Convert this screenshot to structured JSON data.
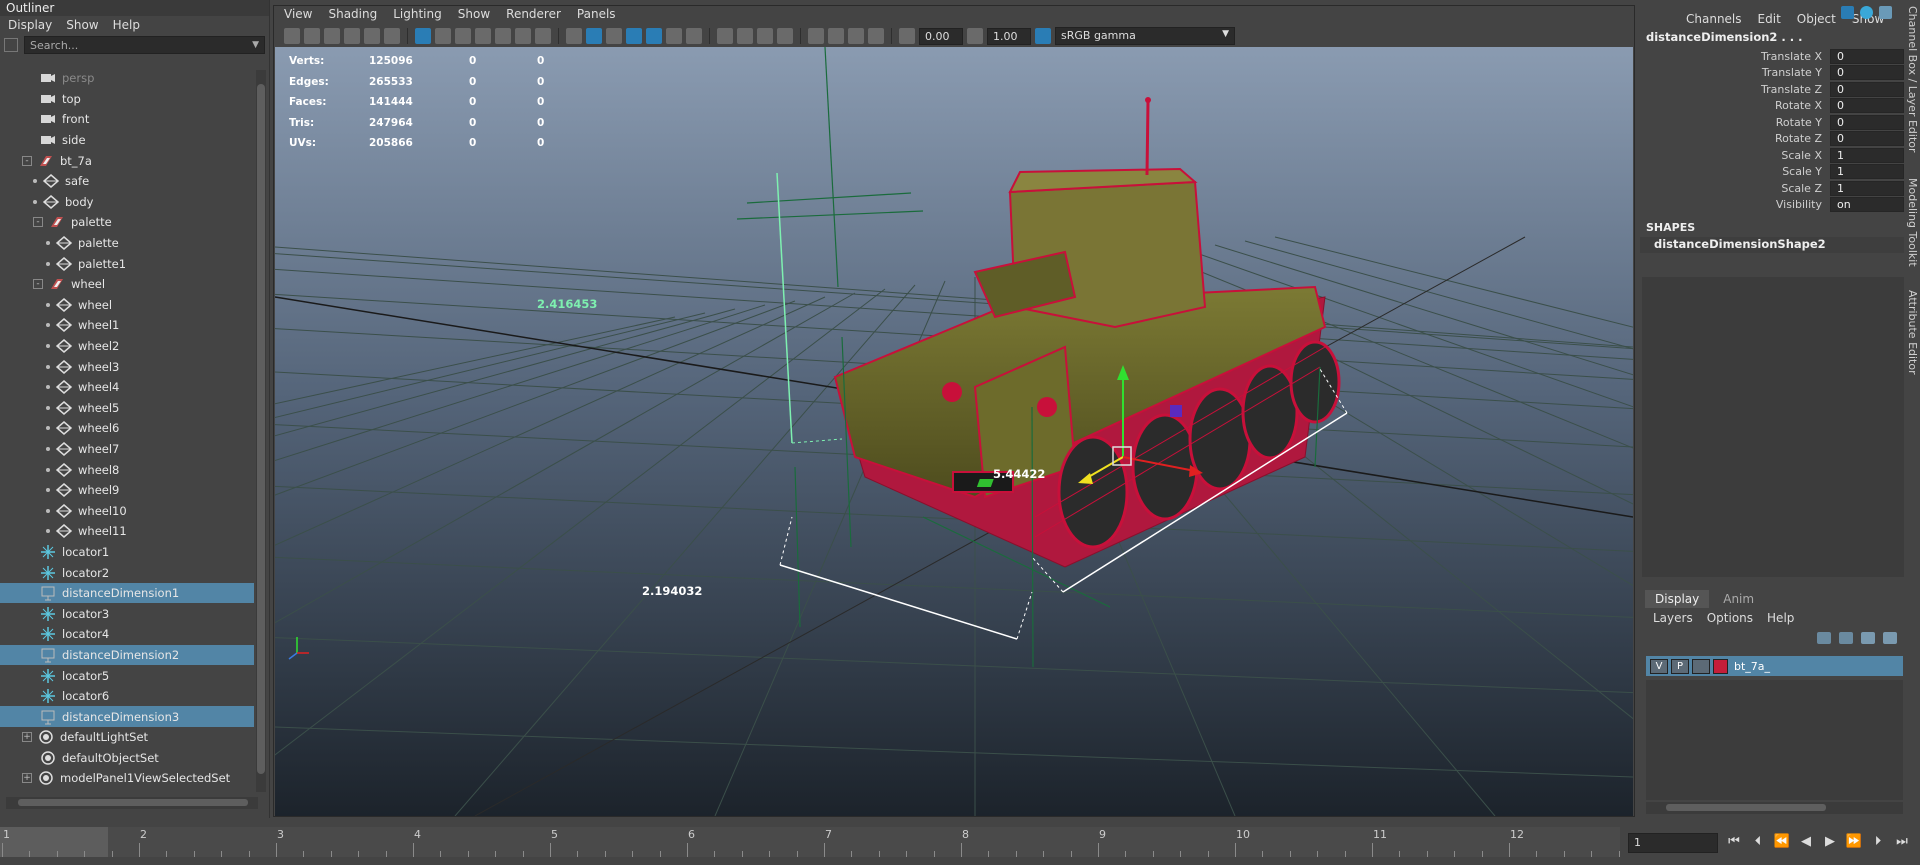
{
  "outliner": {
    "title": "Outliner",
    "menu": [
      "Display",
      "Show",
      "Help"
    ],
    "search_placeholder": "Search...",
    "items": [
      {
        "label": "persp",
        "level": 0,
        "icon": "camera",
        "dim": true
      },
      {
        "label": "top",
        "level": 0,
        "icon": "camera"
      },
      {
        "label": "front",
        "level": 0,
        "icon": "camera"
      },
      {
        "label": "side",
        "level": 0,
        "icon": "camera"
      },
      {
        "label": "bt_7a",
        "level": 0,
        "icon": "group",
        "expander": "-"
      },
      {
        "label": "safe",
        "level": 1,
        "icon": "mesh"
      },
      {
        "label": "body",
        "level": 1,
        "icon": "mesh"
      },
      {
        "label": "palette",
        "level": 1,
        "icon": "group",
        "expander": "-"
      },
      {
        "label": "palette",
        "level": 2,
        "icon": "mesh"
      },
      {
        "label": "palette1",
        "level": 2,
        "icon": "mesh"
      },
      {
        "label": "wheel",
        "level": 1,
        "icon": "group",
        "expander": "-"
      },
      {
        "label": "wheel",
        "level": 2,
        "icon": "mesh"
      },
      {
        "label": "wheel1",
        "level": 2,
        "icon": "mesh"
      },
      {
        "label": "wheel2",
        "level": 2,
        "icon": "mesh"
      },
      {
        "label": "wheel3",
        "level": 2,
        "icon": "mesh"
      },
      {
        "label": "wheel4",
        "level": 2,
        "icon": "mesh"
      },
      {
        "label": "wheel5",
        "level": 2,
        "icon": "mesh"
      },
      {
        "label": "wheel6",
        "level": 2,
        "icon": "mesh"
      },
      {
        "label": "wheel7",
        "level": 2,
        "icon": "mesh"
      },
      {
        "label": "wheel8",
        "level": 2,
        "icon": "mesh"
      },
      {
        "label": "wheel9",
        "level": 2,
        "icon": "mesh"
      },
      {
        "label": "wheel10",
        "level": 2,
        "icon": "mesh"
      },
      {
        "label": "wheel11",
        "level": 2,
        "icon": "mesh"
      },
      {
        "label": "locator1",
        "level": 0,
        "icon": "locator"
      },
      {
        "label": "locator2",
        "level": 0,
        "icon": "locator"
      },
      {
        "label": "distanceDimension1",
        "level": 0,
        "icon": "distance",
        "selected": true
      },
      {
        "label": "locator3",
        "level": 0,
        "icon": "locator"
      },
      {
        "label": "locator4",
        "level": 0,
        "icon": "locator"
      },
      {
        "label": "distanceDimension2",
        "level": 0,
        "icon": "distance",
        "selected": true
      },
      {
        "label": "locator5",
        "level": 0,
        "icon": "locator"
      },
      {
        "label": "locator6",
        "level": 0,
        "icon": "locator"
      },
      {
        "label": "distanceDimension3",
        "level": 0,
        "icon": "distance",
        "selected": true
      },
      {
        "label": "defaultLightSet",
        "level": 0,
        "icon": "set",
        "expander": "+"
      },
      {
        "label": "defaultObjectSet",
        "level": 0,
        "icon": "set"
      },
      {
        "label": "modelPanel1ViewSelectedSet",
        "level": 0,
        "icon": "set",
        "expander": "+"
      }
    ]
  },
  "viewport": {
    "menu": [
      "View",
      "Shading",
      "Lighting",
      "Show",
      "Renderer",
      "Panels"
    ],
    "exposure": "0.00",
    "gamma": "1.00",
    "color_space": "sRGB gamma",
    "hud": [
      {
        "label": "Verts:",
        "v1": "125096",
        "v2": "0",
        "v3": "0"
      },
      {
        "label": "Edges:",
        "v1": "265533",
        "v2": "0",
        "v3": "0"
      },
      {
        "label": "Faces:",
        "v1": "141444",
        "v2": "0",
        "v3": "0"
      },
      {
        "label": "Tris:",
        "v1": "247964",
        "v2": "0",
        "v3": "0"
      },
      {
        "label": "UVs:",
        "v1": "205866",
        "v2": "0",
        "v3": "0"
      }
    ],
    "dimensions": [
      "2.416453",
      "5.44422",
      "2.194032"
    ],
    "colors": {
      "mesh_wire": "#c8103a",
      "mesh_fill": "#6b6a2a",
      "grid": "#1e5a32",
      "dim_green": "#7ef0b0"
    }
  },
  "channel_box": {
    "menu": [
      "Channels",
      "Edit",
      "Object",
      "Show"
    ],
    "object_name": "distanceDimension2 . . .",
    "attributes": [
      {
        "name": "Translate X",
        "value": "0"
      },
      {
        "name": "Translate Y",
        "value": "0"
      },
      {
        "name": "Translate Z",
        "value": "0"
      },
      {
        "name": "Rotate X",
        "value": "0"
      },
      {
        "name": "Rotate Y",
        "value": "0"
      },
      {
        "name": "Rotate Z",
        "value": "0"
      },
      {
        "name": "Scale X",
        "value": "1"
      },
      {
        "name": "Scale Y",
        "value": "1"
      },
      {
        "name": "Scale Z",
        "value": "1"
      },
      {
        "name": "Visibility",
        "value": "on"
      }
    ],
    "shapes_header": "SHAPES",
    "shape_name": "distanceDimensionShape2",
    "side_tabs": [
      "Channel Box / Layer Editor",
      "Modeling Toolkit",
      "Attribute Editor"
    ]
  },
  "layer_editor": {
    "tabs": [
      "Display",
      "Anim"
    ],
    "menu": [
      "Layers",
      "Options",
      "Help"
    ],
    "layer": {
      "v": "V",
      "p": "P",
      "name": "bt_7a_"
    }
  },
  "timeline": {
    "ticks": [
      "1",
      "2",
      "3",
      "4",
      "5",
      "6",
      "7",
      "8",
      "9",
      "10",
      "11",
      "12"
    ],
    "current_frame": "1"
  }
}
